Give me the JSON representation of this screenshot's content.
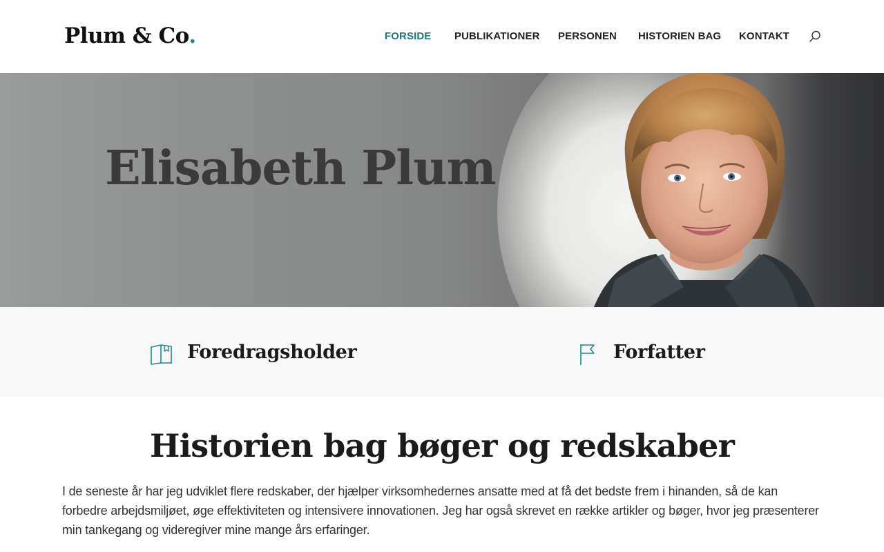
{
  "header": {
    "logo_text": "Plum & Co",
    "logo_dot": ".",
    "nav": [
      {
        "label": "FORSIDE",
        "active": true
      },
      {
        "label": "PUBLIKATIONER",
        "active": false
      },
      {
        "label": "PERSONEN",
        "active": false
      },
      {
        "label": "HISTORIEN BAG",
        "active": false
      },
      {
        "label": "KONTAKT",
        "active": false
      }
    ],
    "search_icon": "search-icon"
  },
  "hero": {
    "title": "Elisabeth Plum",
    "image": "portrait-photo"
  },
  "features": [
    {
      "icon": "book-icon",
      "label": "Foredragsholder"
    },
    {
      "icon": "flag-icon",
      "label": "Forfatter"
    }
  ],
  "main": {
    "title": "Historien bag bøger og redskaber",
    "paragraph": "I de seneste år har jeg udviklet flere redskaber, der hjælper virksomhedernes ansatte med at få det bedste frem i hinanden, så de kan forbedre arbejdsmiljøet, øge effektiviteten og intensivere innovationen. Jeg har også skrevet en række artikler og bøger, hvor jeg præsenterer min tankegang og videregiver mine mange års erfaringer."
  },
  "colors": {
    "accent": "#1a7b78",
    "text": "#222222",
    "band_bg": "#f8f8f8"
  }
}
